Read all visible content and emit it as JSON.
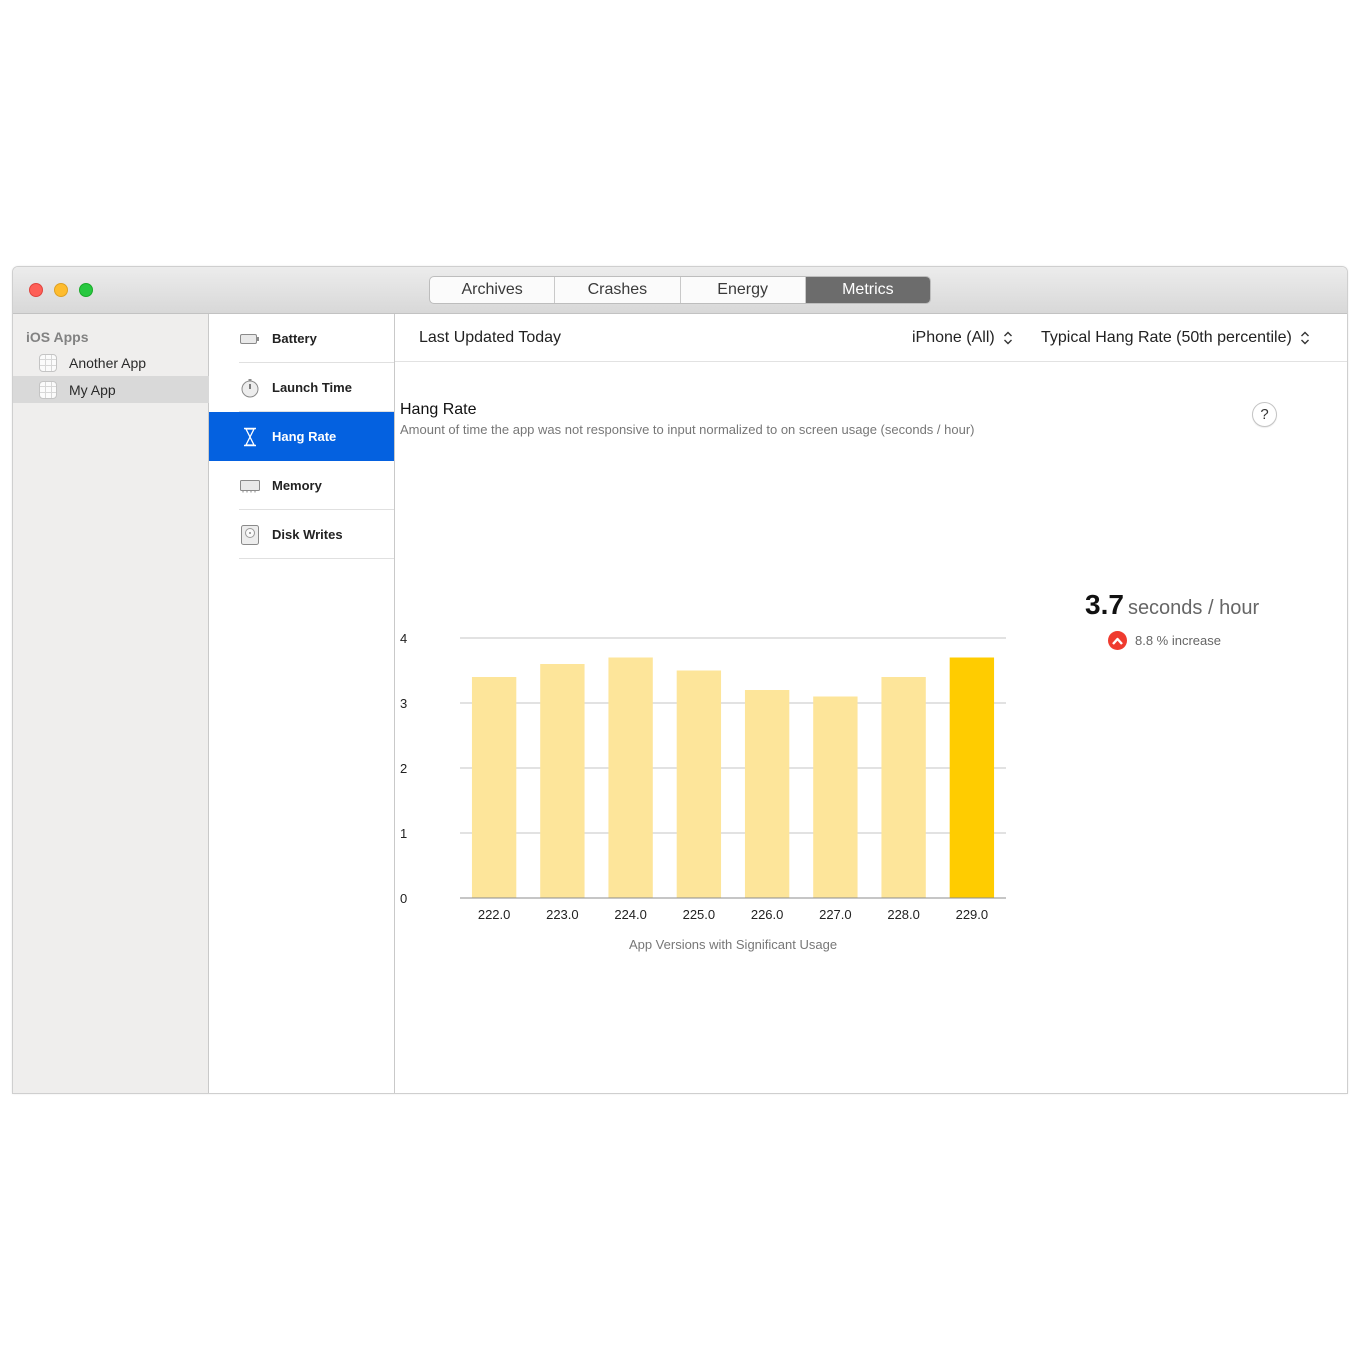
{
  "window": {
    "tabs": [
      {
        "label": "Archives",
        "active": false
      },
      {
        "label": "Crashes",
        "active": false
      },
      {
        "label": "Energy",
        "active": false
      },
      {
        "label": "Metrics",
        "active": true
      }
    ]
  },
  "sidebar": {
    "heading": "iOS Apps",
    "apps": [
      {
        "label": "Another App",
        "selected": false
      },
      {
        "label": "My App",
        "selected": true
      }
    ]
  },
  "metrics_list": {
    "items": [
      {
        "label": "Battery",
        "icon": "battery-icon",
        "selected": false
      },
      {
        "label": "Launch Time",
        "icon": "stopwatch-icon",
        "selected": false
      },
      {
        "label": "Hang Rate",
        "icon": "hourglass-icon",
        "selected": true
      },
      {
        "label": "Memory",
        "icon": "memory-chip-icon",
        "selected": false
      },
      {
        "label": "Disk Writes",
        "icon": "disk-icon",
        "selected": false
      }
    ]
  },
  "header": {
    "last_updated": "Last Updated Today",
    "device_filter": "iPhone (All)",
    "percentile_filter": "Typical Hang Rate (50th percentile)"
  },
  "section": {
    "title": "Hang Rate",
    "subtitle": "Amount of time the app was not responsive to input normalized to on screen usage (seconds / hour)",
    "help_label": "?"
  },
  "summary": {
    "value": "3.7",
    "unit": "seconds / hour",
    "change": "8.8 % increase",
    "change_color": "#ef3b2f"
  },
  "colors": {
    "accent_selected": "#0461e0",
    "bar_default": "#fde59a",
    "bar_highlight": "#ffcc00"
  },
  "chart_data": {
    "type": "bar",
    "title": "",
    "xlabel": "App Versions with Significant Usage",
    "ylabel": "",
    "categories": [
      "222.0",
      "223.0",
      "224.0",
      "225.0",
      "226.0",
      "227.0",
      "228.0",
      "229.0"
    ],
    "values": [
      3.4,
      3.6,
      3.7,
      3.5,
      3.2,
      3.1,
      3.4,
      3.7
    ],
    "highlighted_category": "229.0",
    "ylim": [
      0,
      4
    ],
    "yticks": [
      "0",
      "1",
      "2",
      "3",
      "4"
    ],
    "grid": true,
    "legend": "none"
  }
}
